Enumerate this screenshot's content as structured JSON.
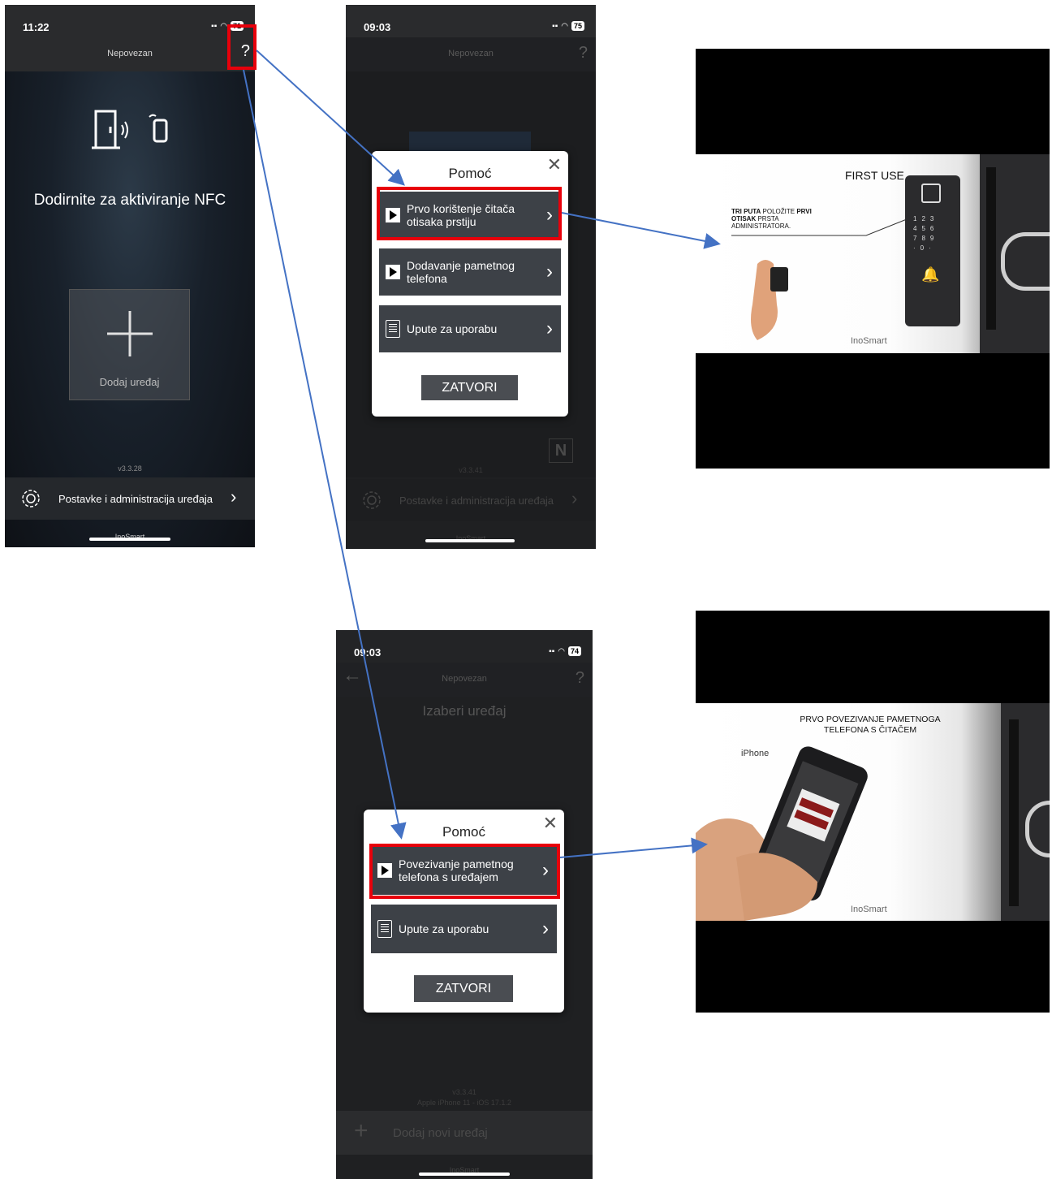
{
  "screen1": {
    "time": "11:22",
    "battery": "71",
    "nav_title": "Nepovezan",
    "help_label": "?",
    "nfc_text": "Dodirnite za aktiviranje NFC",
    "add_device_label": "Dodaj uređaj",
    "version": "v3.3.28",
    "settings_label": "Postavke i administracija uređaja",
    "brand": "InoSmart"
  },
  "screen2": {
    "time": "09:03",
    "battery": "75",
    "nav_title": "Nepovezan",
    "help_label": "?",
    "modal_title": "Pomoć",
    "items": [
      {
        "label": "Prvo korištenje čitača otisaka prstiju",
        "icon": "play-icon"
      },
      {
        "label": "Dodavanje pametnog telefona",
        "icon": "play-icon"
      },
      {
        "label": "Upute za uporabu",
        "icon": "document-icon"
      }
    ],
    "close_button": "ZATVORI",
    "version": "v3.3.41",
    "settings_label": "Postavke i administracija uređaja",
    "brand": "InoSmart"
  },
  "screen3": {
    "time": "09:03",
    "battery": "74",
    "nav_title": "Nepovezan",
    "help_label": "?",
    "header": "Izaberi uređaj",
    "modal_title": "Pomoć",
    "items": [
      {
        "label": "Povezivanje pametnog telefona s uređajem",
        "icon": "play-icon"
      },
      {
        "label": "Upute za uporabu",
        "icon": "document-icon"
      }
    ],
    "close_button": "ZATVORI",
    "version": "v3.3.41",
    "device_info": "Apple iPhone 11 - iOS 17.1.2",
    "add_new_label": "Dodaj novi uređaj",
    "brand": "InoSmart"
  },
  "video1": {
    "title": "FIRST USE",
    "instruction_line1_bold": "TRI PUTA",
    "instruction_line1_rest": " POLOŽITE ",
    "instruction_line1_bold2": "PRVI",
    "instruction_line2_bold": "OTISAK",
    "instruction_line2_rest": " PRSTA",
    "instruction_line3": "ADMINISTRATORA.",
    "brand": "InoSmart"
  },
  "video2": {
    "title_line1": "PRVO POVEZIVANJE PAMETNOGA",
    "title_line2": "TELEFONA S ČITAČEM",
    "device_label": "iPhone",
    "brand": "InoSmart"
  },
  "colors": {
    "highlight": "#e8000b",
    "arrow": "#4472c4",
    "dark_bg": "#2a2b2d",
    "item_bg": "#3d4147"
  }
}
